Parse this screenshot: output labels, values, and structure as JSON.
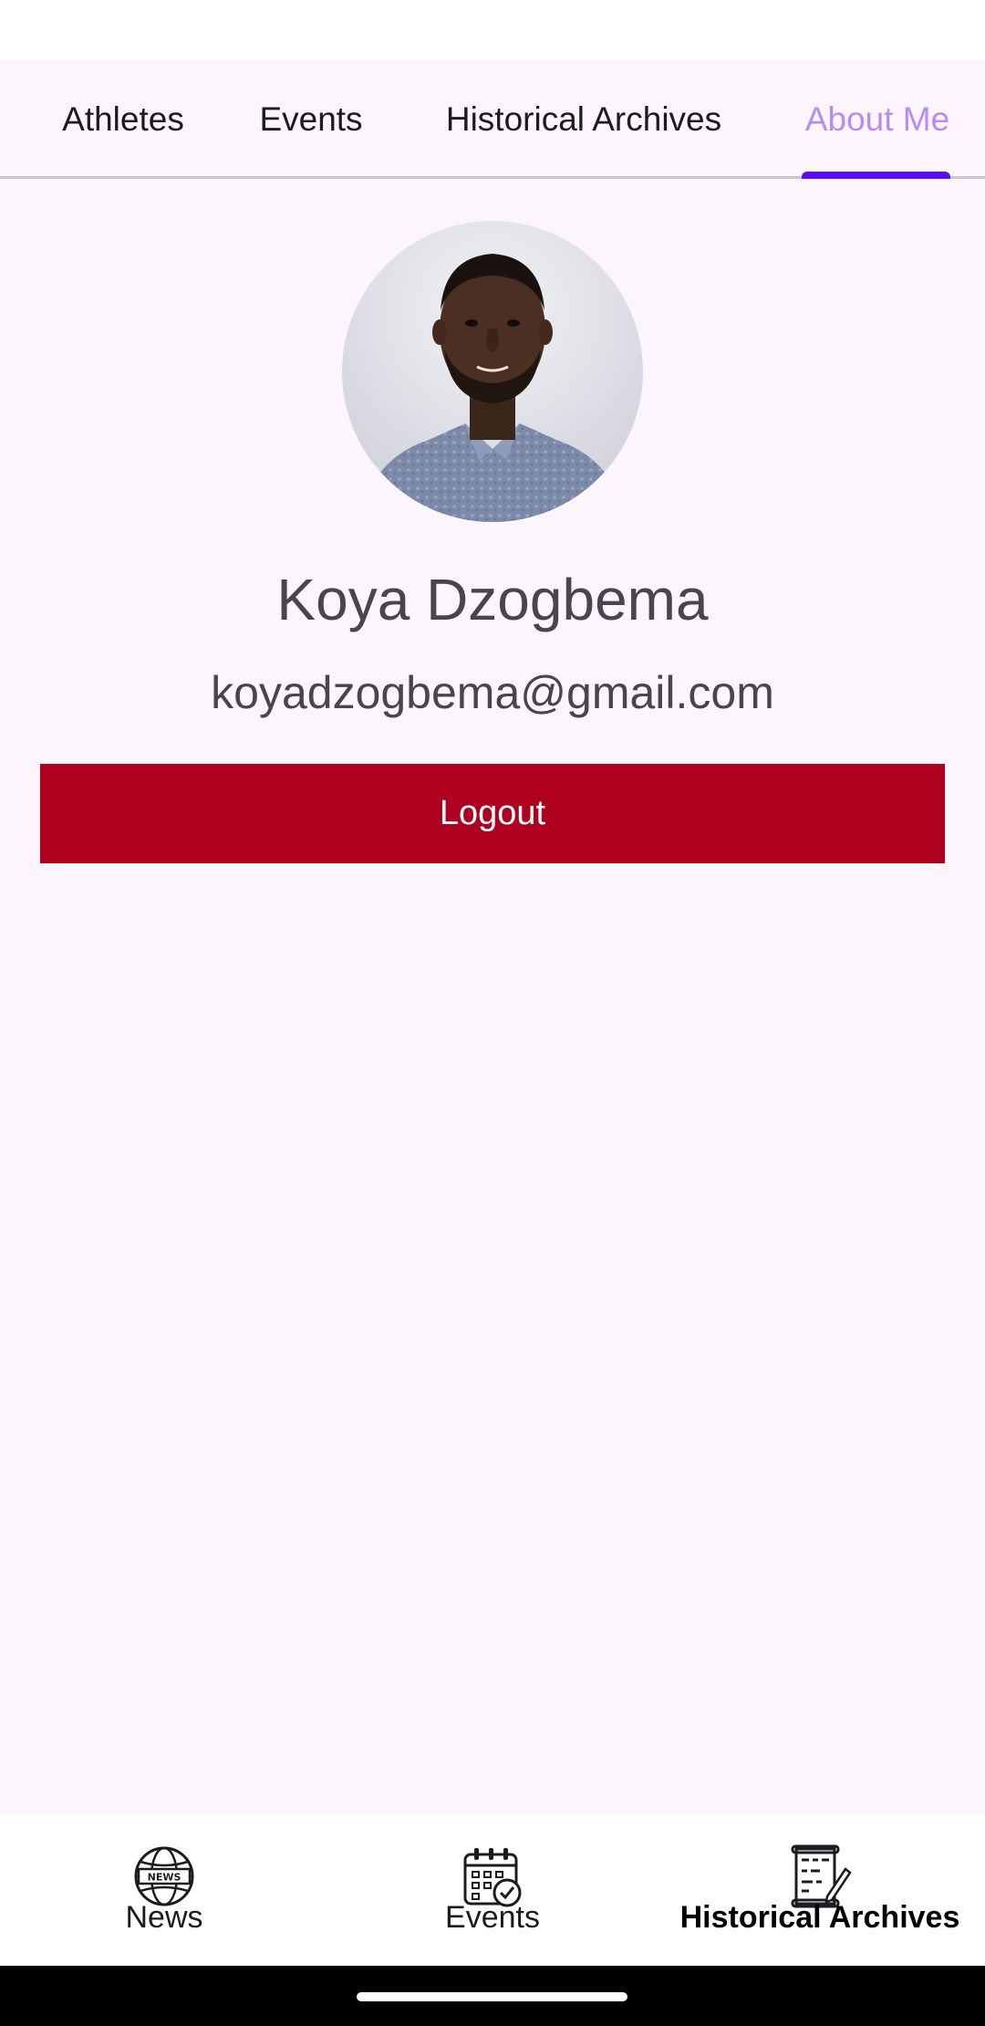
{
  "tabs": [
    {
      "label": "Athletes",
      "active": false
    },
    {
      "label": "Events",
      "active": false
    },
    {
      "label": "Historical Archives",
      "active": false
    },
    {
      "label": "About Me",
      "active": true
    }
  ],
  "profile": {
    "name": "Koya Dzogbema",
    "email": "koyadzogbema@gmail.com",
    "logout_label": "Logout"
  },
  "bottom_nav": [
    {
      "label": "News",
      "icon": "news-globe-icon"
    },
    {
      "label": "Events",
      "icon": "calendar-check-icon"
    },
    {
      "label": "Historical Archives",
      "icon": "archive-scroll-icon"
    }
  ],
  "colors": {
    "background": "#fdf5fc",
    "active_tab_text": "#b98cf0",
    "tab_indicator": "#5b0ee8",
    "logout_button": "#b00020",
    "text_secondary": "#49454f"
  }
}
